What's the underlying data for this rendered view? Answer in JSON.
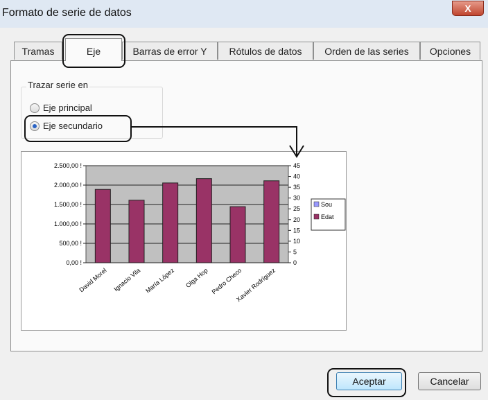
{
  "window": {
    "title": "Formato de serie de datos",
    "close_glyph": "X"
  },
  "tabs": [
    {
      "label": "Tramas"
    },
    {
      "label": "Eje"
    },
    {
      "label": "Barras de error Y"
    },
    {
      "label": "Rótulos de datos"
    },
    {
      "label": "Orden de las series"
    },
    {
      "label": "Opciones"
    }
  ],
  "active_tab": "Eje",
  "plot_on": {
    "label": "Trazar serie en",
    "options": [
      {
        "label": "Eje principal",
        "checked": false
      },
      {
        "label": "Eje secundario",
        "checked": true
      }
    ]
  },
  "chart_data": {
    "type": "bar",
    "categories": [
      "David Morel",
      "Ignacio Vila",
      "María López",
      "Olga Hop",
      "Pedro Checo",
      "Xavier Rodríguez"
    ],
    "series": [
      {
        "name": "Sou",
        "values": [
          0,
          0,
          0,
          0,
          0,
          0
        ],
        "color": "#9999ff"
      },
      {
        "name": "Edat",
        "values": [
          34,
          29,
          37,
          39,
          26,
          38
        ],
        "color": "#993366"
      }
    ],
    "primary_ticks": [
      "2.500,00 !",
      "2.000,00 !",
      "1.500,00 !",
      "1.000,00 !",
      "500,00 !",
      "0,00 !"
    ],
    "ylim": [
      0,
      2500000
    ],
    "secondary_ticks": [
      "45",
      "40",
      "35",
      "30",
      "25",
      "20",
      "15",
      "10",
      "5",
      "0"
    ],
    "y2lim": [
      0,
      45
    ],
    "plot_background": "#c0c0c0",
    "grid": true,
    "legend": "right"
  },
  "buttons": {
    "ok": "Aceptar",
    "cancel": "Cancelar"
  },
  "colors": {
    "bar": "#993366",
    "title_bar": "#dfe8f3",
    "close": "#c0462f"
  }
}
